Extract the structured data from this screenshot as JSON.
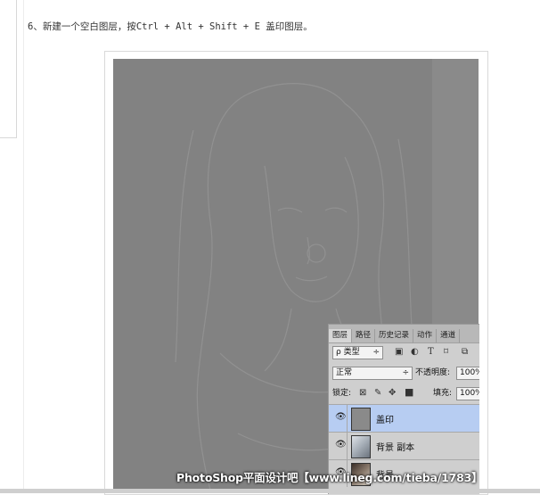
{
  "step": {
    "text": "6、新建一个空白图层，按Ctrl + Alt + Shift + E 盖印图层。"
  },
  "layers_panel": {
    "tabs": [
      "图层",
      "路径",
      "历史记录",
      "动作",
      "通道"
    ],
    "filter_label": "ρ 类型",
    "filter_arrow": "÷",
    "blend_mode": {
      "value": "正常",
      "arrow": "÷"
    },
    "opacity": {
      "label": "不透明度:",
      "value": "100%"
    },
    "lock": {
      "label": "锁定:"
    },
    "fill": {
      "label": "填充:",
      "value": "100%"
    },
    "layers": [
      {
        "name": "盖印",
        "selected": true
      },
      {
        "name": "背景 副本",
        "selected": false
      },
      {
        "name": "背景",
        "selected": false
      }
    ]
  },
  "watermark": {
    "text": "PhotoShop平面设计吧【www.lineg.com/tieba/1783】"
  },
  "colors": {
    "canvas": "#828282",
    "panel": "#cfcfcf",
    "selection": "#b7cdf2"
  },
  "icons": [
    "eye-icon",
    "image-filter-icon",
    "adjustment-filter-icon",
    "type-filter-icon",
    "shape-filter-icon",
    "smart-filter-icon",
    "lock-pixels-icon",
    "lock-brush-icon",
    "lock-move-icon",
    "lock-all-icon"
  ]
}
